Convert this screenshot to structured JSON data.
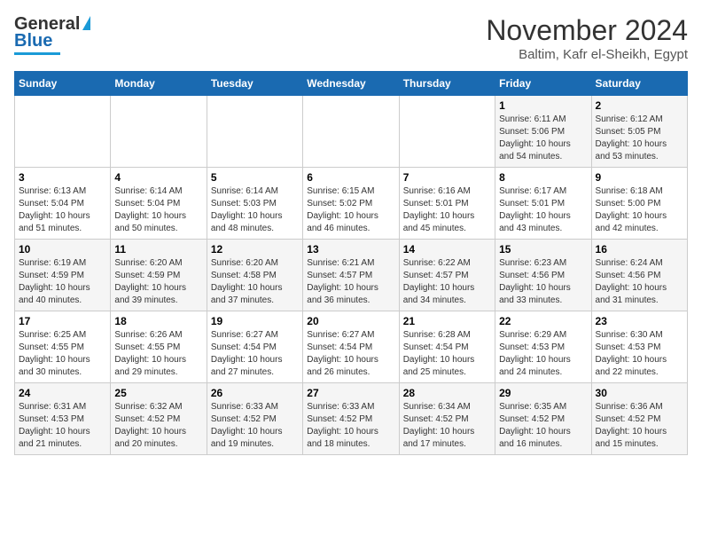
{
  "logo": {
    "line1": "General",
    "line2": "Blue"
  },
  "header": {
    "month": "November 2024",
    "location": "Baltim, Kafr el-Sheikh, Egypt"
  },
  "days_of_week": [
    "Sunday",
    "Monday",
    "Tuesday",
    "Wednesday",
    "Thursday",
    "Friday",
    "Saturday"
  ],
  "weeks": [
    [
      {
        "day": "",
        "info": ""
      },
      {
        "day": "",
        "info": ""
      },
      {
        "day": "",
        "info": ""
      },
      {
        "day": "",
        "info": ""
      },
      {
        "day": "",
        "info": ""
      },
      {
        "day": "1",
        "info": "Sunrise: 6:11 AM\nSunset: 5:06 PM\nDaylight: 10 hours\nand 54 minutes."
      },
      {
        "day": "2",
        "info": "Sunrise: 6:12 AM\nSunset: 5:05 PM\nDaylight: 10 hours\nand 53 minutes."
      }
    ],
    [
      {
        "day": "3",
        "info": "Sunrise: 6:13 AM\nSunset: 5:04 PM\nDaylight: 10 hours\nand 51 minutes."
      },
      {
        "day": "4",
        "info": "Sunrise: 6:14 AM\nSunset: 5:04 PM\nDaylight: 10 hours\nand 50 minutes."
      },
      {
        "day": "5",
        "info": "Sunrise: 6:14 AM\nSunset: 5:03 PM\nDaylight: 10 hours\nand 48 minutes."
      },
      {
        "day": "6",
        "info": "Sunrise: 6:15 AM\nSunset: 5:02 PM\nDaylight: 10 hours\nand 46 minutes."
      },
      {
        "day": "7",
        "info": "Sunrise: 6:16 AM\nSunset: 5:01 PM\nDaylight: 10 hours\nand 45 minutes."
      },
      {
        "day": "8",
        "info": "Sunrise: 6:17 AM\nSunset: 5:01 PM\nDaylight: 10 hours\nand 43 minutes."
      },
      {
        "day": "9",
        "info": "Sunrise: 6:18 AM\nSunset: 5:00 PM\nDaylight: 10 hours\nand 42 minutes."
      }
    ],
    [
      {
        "day": "10",
        "info": "Sunrise: 6:19 AM\nSunset: 4:59 PM\nDaylight: 10 hours\nand 40 minutes."
      },
      {
        "day": "11",
        "info": "Sunrise: 6:20 AM\nSunset: 4:59 PM\nDaylight: 10 hours\nand 39 minutes."
      },
      {
        "day": "12",
        "info": "Sunrise: 6:20 AM\nSunset: 4:58 PM\nDaylight: 10 hours\nand 37 minutes."
      },
      {
        "day": "13",
        "info": "Sunrise: 6:21 AM\nSunset: 4:57 PM\nDaylight: 10 hours\nand 36 minutes."
      },
      {
        "day": "14",
        "info": "Sunrise: 6:22 AM\nSunset: 4:57 PM\nDaylight: 10 hours\nand 34 minutes."
      },
      {
        "day": "15",
        "info": "Sunrise: 6:23 AM\nSunset: 4:56 PM\nDaylight: 10 hours\nand 33 minutes."
      },
      {
        "day": "16",
        "info": "Sunrise: 6:24 AM\nSunset: 4:56 PM\nDaylight: 10 hours\nand 31 minutes."
      }
    ],
    [
      {
        "day": "17",
        "info": "Sunrise: 6:25 AM\nSunset: 4:55 PM\nDaylight: 10 hours\nand 30 minutes."
      },
      {
        "day": "18",
        "info": "Sunrise: 6:26 AM\nSunset: 4:55 PM\nDaylight: 10 hours\nand 29 minutes."
      },
      {
        "day": "19",
        "info": "Sunrise: 6:27 AM\nSunset: 4:54 PM\nDaylight: 10 hours\nand 27 minutes."
      },
      {
        "day": "20",
        "info": "Sunrise: 6:27 AM\nSunset: 4:54 PM\nDaylight: 10 hours\nand 26 minutes."
      },
      {
        "day": "21",
        "info": "Sunrise: 6:28 AM\nSunset: 4:54 PM\nDaylight: 10 hours\nand 25 minutes."
      },
      {
        "day": "22",
        "info": "Sunrise: 6:29 AM\nSunset: 4:53 PM\nDaylight: 10 hours\nand 24 minutes."
      },
      {
        "day": "23",
        "info": "Sunrise: 6:30 AM\nSunset: 4:53 PM\nDaylight: 10 hours\nand 22 minutes."
      }
    ],
    [
      {
        "day": "24",
        "info": "Sunrise: 6:31 AM\nSunset: 4:53 PM\nDaylight: 10 hours\nand 21 minutes."
      },
      {
        "day": "25",
        "info": "Sunrise: 6:32 AM\nSunset: 4:52 PM\nDaylight: 10 hours\nand 20 minutes."
      },
      {
        "day": "26",
        "info": "Sunrise: 6:33 AM\nSunset: 4:52 PM\nDaylight: 10 hours\nand 19 minutes."
      },
      {
        "day": "27",
        "info": "Sunrise: 6:33 AM\nSunset: 4:52 PM\nDaylight: 10 hours\nand 18 minutes."
      },
      {
        "day": "28",
        "info": "Sunrise: 6:34 AM\nSunset: 4:52 PM\nDaylight: 10 hours\nand 17 minutes."
      },
      {
        "day": "29",
        "info": "Sunrise: 6:35 AM\nSunset: 4:52 PM\nDaylight: 10 hours\nand 16 minutes."
      },
      {
        "day": "30",
        "info": "Sunrise: 6:36 AM\nSunset: 4:52 PM\nDaylight: 10 hours\nand 15 minutes."
      }
    ]
  ]
}
